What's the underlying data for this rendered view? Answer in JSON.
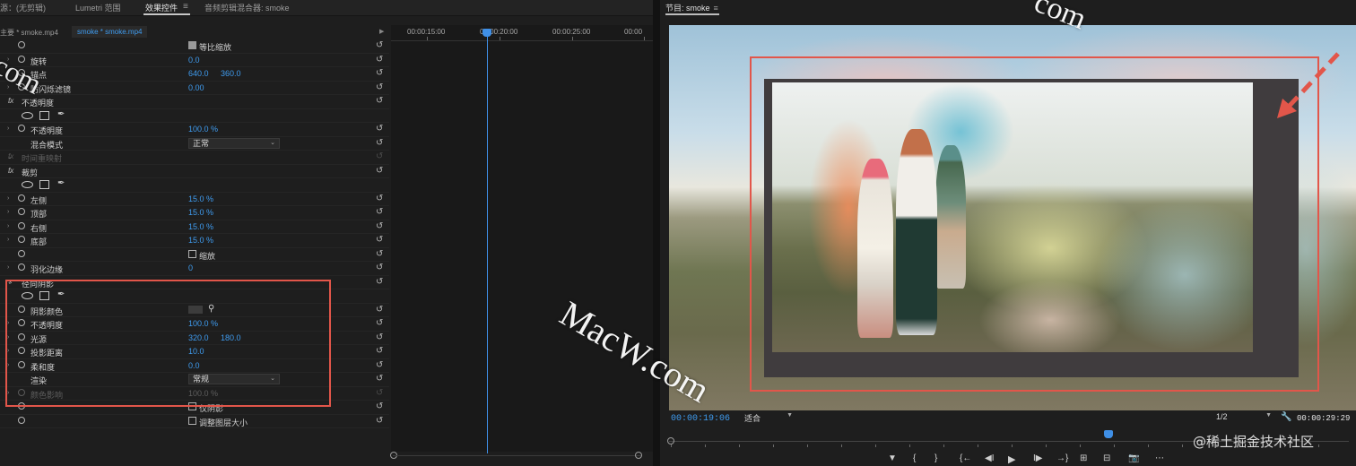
{
  "tabs": [
    {
      "label": "源：(无剪辑)"
    },
    {
      "label": "Lumetri 范围"
    },
    {
      "label": "效果控件"
    },
    {
      "label": "音频剪辑混合器: smoke"
    }
  ],
  "source": {
    "master": "主要 * smoke.mp4",
    "clip": "smoke * smoke.mp4"
  },
  "timeline": {
    "labels": [
      "00:00:15:00",
      "00:00:20:00",
      "00:00:25:00",
      "00:00"
    ]
  },
  "rows": [
    {
      "type": "check",
      "checked": true,
      "label": "等比缩放"
    },
    {
      "type": "param",
      "label": "旋转",
      "values": [
        "0.0"
      ]
    },
    {
      "type": "param",
      "label": "锚点",
      "values": [
        "640.0",
        "360.0"
      ]
    },
    {
      "type": "param",
      "label": "防闪烁滤镜",
      "values": [
        "0.00"
      ]
    },
    {
      "type": "section",
      "fx": true,
      "label": "不透明度"
    },
    {
      "type": "masktools"
    },
    {
      "type": "param",
      "label": "不透明度",
      "values": [
        "100.0 %"
      ]
    },
    {
      "type": "select",
      "label": "混合模式",
      "value": "正常"
    },
    {
      "type": "section",
      "fx": true,
      "dim": true,
      "label": "时间重映射"
    },
    {
      "type": "section",
      "fx": true,
      "label": "裁剪"
    },
    {
      "type": "masktools"
    },
    {
      "type": "param",
      "label": "左侧",
      "values": [
        "15.0 %"
      ]
    },
    {
      "type": "param",
      "label": "顶部",
      "values": [
        "15.0 %"
      ]
    },
    {
      "type": "param",
      "label": "右侧",
      "values": [
        "15.0 %"
      ]
    },
    {
      "type": "param",
      "label": "底部",
      "values": [
        "15.0 %"
      ]
    },
    {
      "type": "check",
      "checked": false,
      "label": "缩放"
    },
    {
      "type": "param",
      "label": "羽化边缘",
      "values": [
        "0"
      ]
    },
    {
      "type": "section",
      "fx": false,
      "label": "径向阴影"
    },
    {
      "type": "masktools"
    },
    {
      "type": "color",
      "label": "阴影颜色"
    },
    {
      "type": "param",
      "label": "不透明度",
      "values": [
        "100.0 %"
      ]
    },
    {
      "type": "param",
      "label": "光源",
      "values": [
        "320.0",
        "180.0"
      ]
    },
    {
      "type": "param",
      "label": "投影距离",
      "values": [
        "10.0"
      ]
    },
    {
      "type": "param",
      "label": "柔和度",
      "values": [
        "0.0"
      ]
    },
    {
      "type": "select",
      "label": "渲染",
      "value": "常规"
    },
    {
      "type": "param",
      "dim": true,
      "label": "颜色影响",
      "values": [
        "100.0 %"
      ]
    },
    {
      "type": "check",
      "checked": false,
      "label": "仅阴影"
    },
    {
      "type": "check",
      "checked": false,
      "label": "调整图层大小"
    }
  ],
  "program": {
    "title": "节目: smoke",
    "timecode": "00:00:19:06",
    "fit": "适合",
    "resolution": "1/2",
    "duration": "00:00:29:29"
  },
  "transport": [
    "▼",
    "{",
    "}",
    "{←",
    "◀I",
    "▶",
    "I▶",
    "→}",
    "⊞",
    "⊟",
    "📷",
    "⋯"
  ],
  "watermarks": {
    "left": "com",
    "middle": "MacW.com",
    "top": "com"
  },
  "credit": "@稀土掘金技术社区"
}
